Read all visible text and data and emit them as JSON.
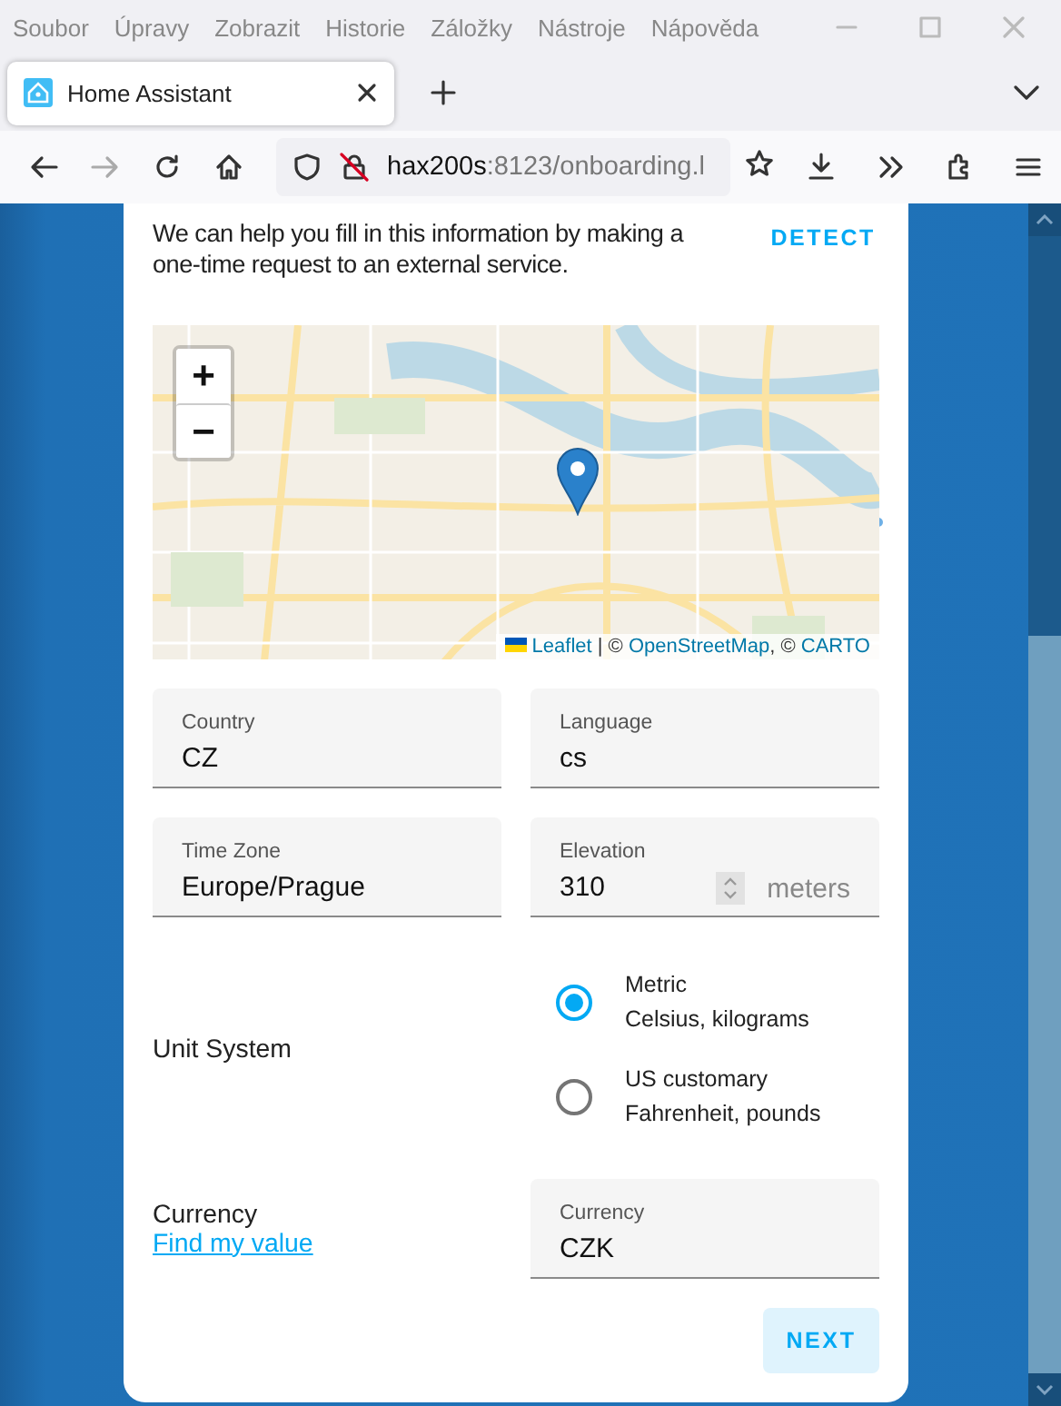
{
  "menu_bar": [
    "Soubor",
    "Úpravy",
    "Zobrazit",
    "Historie",
    "Záložky",
    "Nástroje",
    "Nápověda"
  ],
  "tab": {
    "title": "Home Assistant",
    "selected": true
  },
  "address_bar": {
    "host": "hax200s",
    "path": ":8123/onboarding.l"
  },
  "intro": {
    "text": "We can help you fill in this information by making a one-time request to an external service.",
    "detect_button": "DETECT"
  },
  "map": {
    "zoom_in": "+",
    "zoom_out": "−",
    "attribution": [
      {
        "kind": "link",
        "text": "Leaflet"
      },
      {
        "kind": "text",
        "text": " | © "
      },
      {
        "kind": "link",
        "text": "OpenStreetMap"
      },
      {
        "kind": "text",
        "text": ", © "
      },
      {
        "kind": "link",
        "text": "CARTO"
      }
    ]
  },
  "fields": [
    {
      "label": "Country",
      "value": "CZ",
      "kind": "select"
    },
    {
      "label": "Language",
      "value": "cs",
      "kind": "select"
    },
    {
      "label": "Time Zone",
      "value": "Europe/Prague",
      "kind": "select"
    },
    {
      "label": "Elevation",
      "value": "310",
      "kind": "number",
      "suffix": "meters"
    }
  ],
  "unit_system": {
    "label": "Unit System",
    "options": [
      {
        "title": "Metric",
        "subtitle": "Celsius, kilograms",
        "selected": true
      },
      {
        "title": "US customary",
        "subtitle": "Fahrenheit, pounds",
        "selected": false
      }
    ]
  },
  "currency": {
    "label": "Currency",
    "link": "Find my value",
    "field": {
      "label": "Currency",
      "value": "CZK"
    }
  },
  "next_button": "NEXT"
}
